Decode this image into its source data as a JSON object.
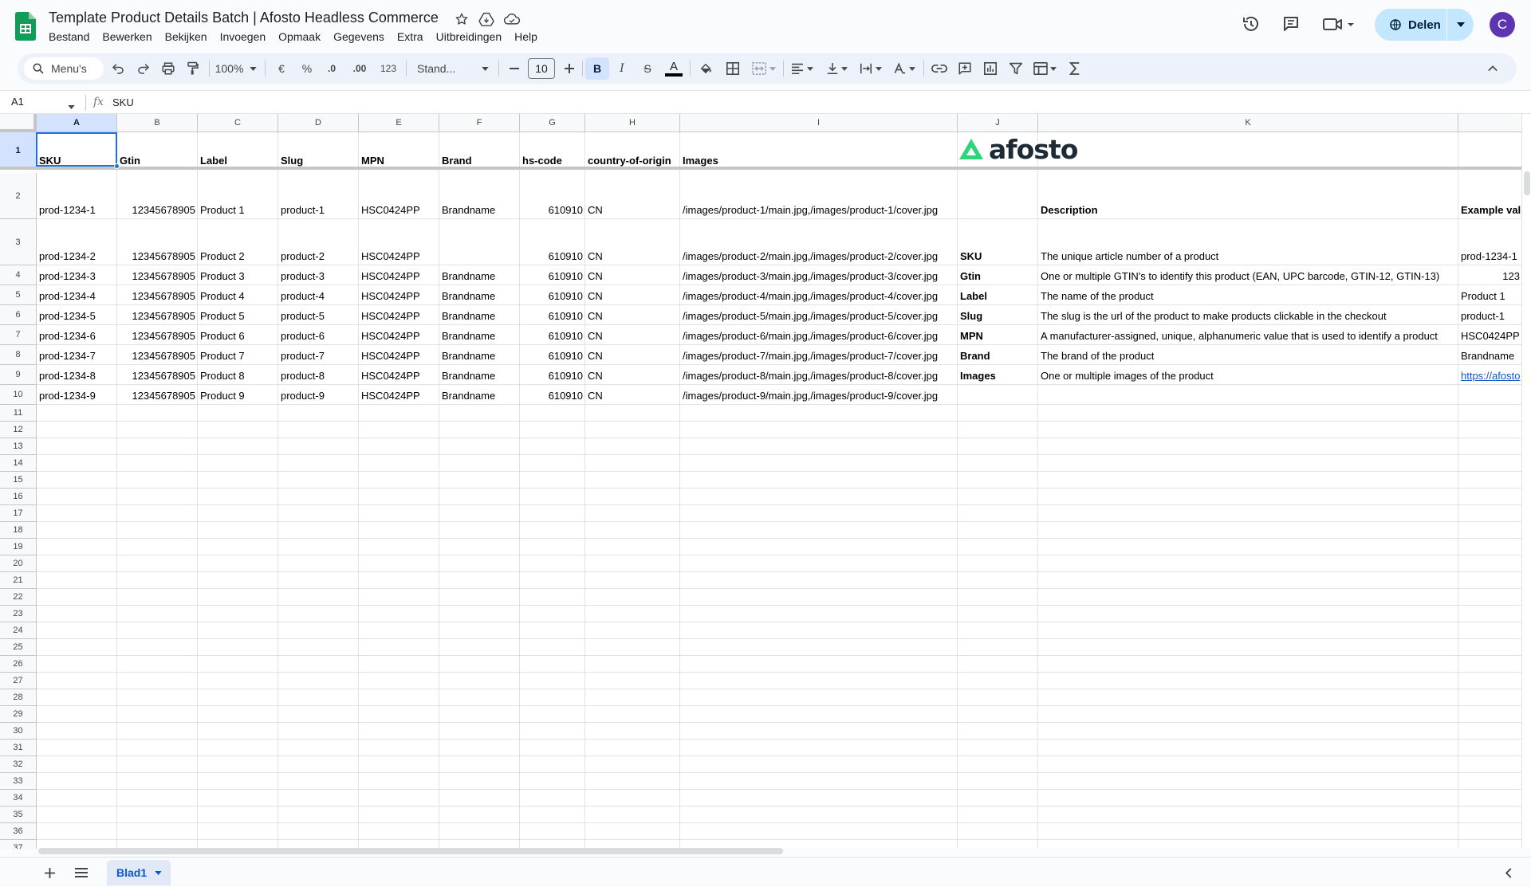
{
  "app": {
    "title": "Template Product Details Batch | Afosto Headless Commerce",
    "menus": [
      "Bestand",
      "Bewerken",
      "Bekijken",
      "Invoegen",
      "Opmaak",
      "Gegevens",
      "Extra",
      "Uitbreidingen",
      "Help"
    ],
    "share_label": "Delen",
    "avatar_letter": "C"
  },
  "toolbar": {
    "search_label": "Menu's",
    "zoom": "100%",
    "currency": "€",
    "percent": "%",
    "dec_decrease": ".0",
    "dec_increase": ".00",
    "number_format": "123",
    "font": "Stand...",
    "font_size": "10",
    "bold": "B",
    "italic": "I",
    "strike": "S",
    "text_color": "A",
    "text_color_hex": "#000000"
  },
  "formula_bar": {
    "cell_ref": "A1",
    "fx": "fx",
    "value": "SKU"
  },
  "grid": {
    "columns": [
      "A",
      "B",
      "C",
      "D",
      "E",
      "F",
      "G",
      "H",
      "I",
      "J",
      "K",
      ""
    ],
    "rows": [
      "1",
      "2",
      "3",
      "4",
      "5",
      "6",
      "7",
      "8",
      "9",
      "10",
      "11",
      "12",
      "13",
      "14",
      "15",
      "16",
      "17",
      "18",
      "19",
      "20",
      "21",
      "22",
      "23",
      "24",
      "25",
      "26",
      "27",
      "28",
      "29",
      "30",
      "31",
      "32",
      "33",
      "34",
      "35",
      "36",
      "37"
    ],
    "header_row": [
      "SKU",
      "Gtin",
      "Label",
      "Slug",
      "MPN",
      "Brand",
      "hs-code",
      "country-of-origin",
      "Images"
    ],
    "products": [
      [
        "prod-1234-1",
        "12345678905",
        "Product 1",
        "product-1",
        "HSC0424PP",
        "Brandname",
        "610910",
        "CN",
        "/images/product-1/main.jpg,/images/product-1/cover.jpg"
      ],
      [
        "prod-1234-2",
        "12345678905",
        "Product 2",
        "product-2",
        "HSC0424PP",
        "",
        "610910",
        "CN",
        "/images/product-2/main.jpg,/images/product-2/cover.jpg"
      ],
      [
        "prod-1234-3",
        "12345678905",
        "Product 3",
        "product-3",
        "HSC0424PP",
        "Brandname",
        "610910",
        "CN",
        "/images/product-3/main.jpg,/images/product-3/cover.jpg"
      ],
      [
        "prod-1234-4",
        "12345678905",
        "Product 4",
        "product-4",
        "HSC0424PP",
        "Brandname",
        "610910",
        "CN",
        "/images/product-4/main.jpg,/images/product-4/cover.jpg"
      ],
      [
        "prod-1234-5",
        "12345678905",
        "Product 5",
        "product-5",
        "HSC0424PP",
        "Brandname",
        "610910",
        "CN",
        "/images/product-5/main.jpg,/images/product-5/cover.jpg"
      ],
      [
        "prod-1234-6",
        "12345678905",
        "Product 6",
        "product-6",
        "HSC0424PP",
        "Brandname",
        "610910",
        "CN",
        "/images/product-6/main.jpg,/images/product-6/cover.jpg"
      ],
      [
        "prod-1234-7",
        "12345678905",
        "Product 7",
        "product-7",
        "HSC0424PP",
        "Brandname",
        "610910",
        "CN",
        "/images/product-7/main.jpg,/images/product-7/cover.jpg"
      ],
      [
        "prod-1234-8",
        "12345678905",
        "Product 8",
        "product-8",
        "HSC0424PP",
        "Brandname",
        "610910",
        "CN",
        "/images/product-8/main.jpg,/images/product-8/cover.jpg"
      ],
      [
        "prod-1234-9",
        "12345678905",
        "Product 9",
        "product-9",
        "HSC0424PP",
        "Brandname",
        "610910",
        "CN",
        "/images/product-9/main.jpg,/images/product-9/cover.jpg"
      ]
    ],
    "logo_text": "afosto",
    "legend_header": {
      "description": "Description",
      "example": "Example val"
    },
    "legend": [
      {
        "field": "SKU",
        "description": "The unique article number of a product",
        "example": "prod-1234-1",
        "example_align": "left"
      },
      {
        "field": "Gtin",
        "description": "One or multiple GTIN's to identify this product (EAN, UPC barcode, GTIN-12, GTIN-13)",
        "example": "123",
        "example_align": "right"
      },
      {
        "field": "Label",
        "description": "The name of the product",
        "example": "Product 1",
        "example_align": "left"
      },
      {
        "field": "Slug",
        "description": "The slug is the url of the product to make products clickable in the checkout",
        "example": "product-1",
        "example_align": "left"
      },
      {
        "field": "MPN",
        "description": "A manufacturer-assigned, unique, alphanumeric value that is used to identify a product",
        "example": "HSC0424PP",
        "example_align": "left"
      },
      {
        "field": "Brand",
        "description": "The brand of the product",
        "example": "Brandname",
        "example_align": "left"
      },
      {
        "field": "Images",
        "description": "One or multiple images of the product",
        "example": "https://afosto",
        "example_align": "left",
        "is_link": true
      }
    ]
  },
  "sheets": {
    "active": "Blad1"
  },
  "colors": {
    "accent": "#1a73e8",
    "share_bg": "#c2e7ff",
    "avatar_bg": "#5e35b1",
    "logo_green": "#2ed47a",
    "link": "#1155cc"
  }
}
